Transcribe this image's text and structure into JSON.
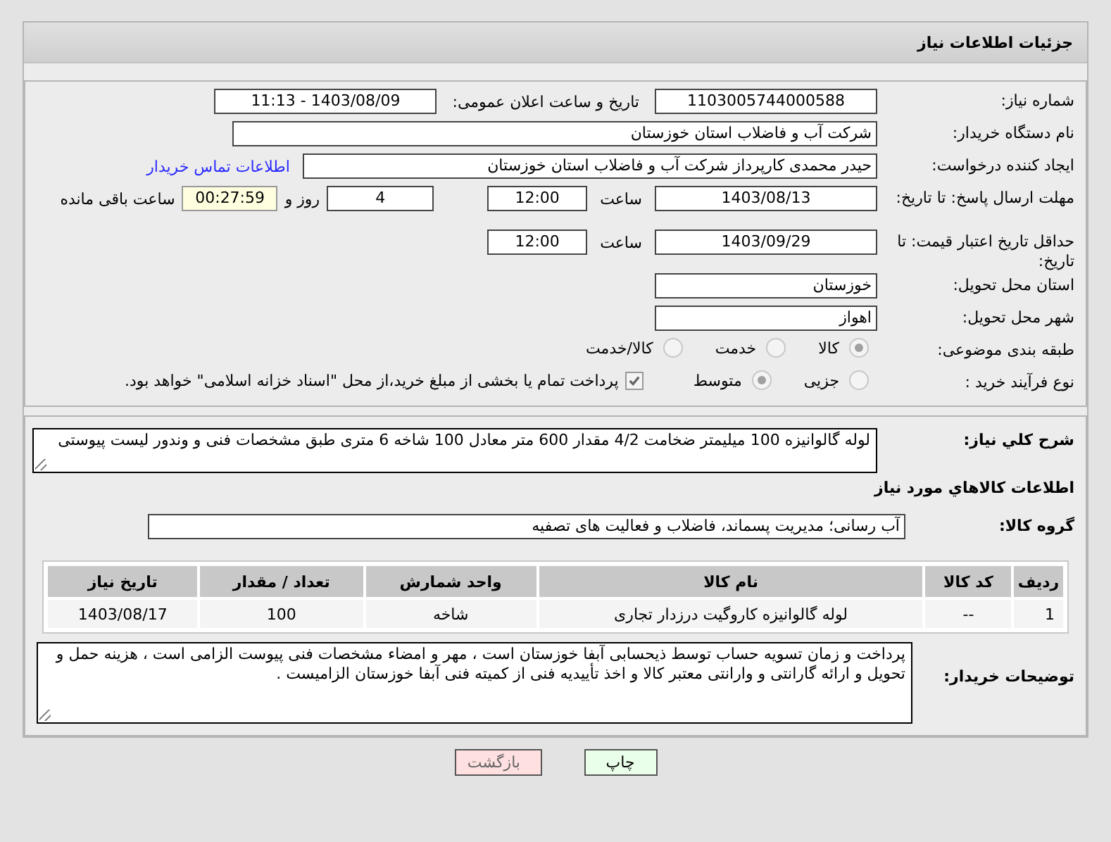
{
  "header": {
    "title": "جزئیات اطلاعات نیاز"
  },
  "need_number": {
    "label": "شماره نیاز:",
    "value": "1103005744000588"
  },
  "announce": {
    "label": "تاریخ و ساعت اعلان عمومی:",
    "value": "1403/08/09 - 11:13"
  },
  "buyer": {
    "label": "نام دستگاه خریدار:",
    "value": "شرکت آب و فاضلاب استان خوزستان"
  },
  "requester": {
    "label": "ایجاد کننده درخواست:",
    "value": "حیدر محمدی کارپرداز شرکت آب و فاضلاب استان خوزستان",
    "link": "اطلاعات تماس خریدار"
  },
  "reply_deadline": {
    "label": "مهلت ارسال پاسخ: تا تاریخ:",
    "date": "1403/08/13",
    "time_label": "ساعت",
    "time": "12:00",
    "days": "4",
    "days_label": "روز و",
    "remaining": "00:27:59",
    "remaining_label": "ساعت باقی مانده"
  },
  "price_validity": {
    "label": "حداقل تاریخ اعتبار قیمت: تا تاریخ:",
    "date": "1403/09/29",
    "time_label": "ساعت",
    "time": "12:00"
  },
  "province": {
    "label": "استان محل تحویل:",
    "value": "خوزستان"
  },
  "city": {
    "label": "شهر محل تحویل:",
    "value": "اهواز"
  },
  "category": {
    "label": "طبقه بندی موضوعی:",
    "options": [
      {
        "label": "کالا",
        "selected": true
      },
      {
        "label": "خدمت",
        "selected": false
      },
      {
        "label": "کالا/خدمت",
        "selected": false
      }
    ]
  },
  "purchase_type": {
    "label": "نوع فرآیند خرید :",
    "options": [
      {
        "label": "جزیی",
        "selected": false
      },
      {
        "label": "متوسط",
        "selected": true
      }
    ],
    "payment": {
      "text": "پرداخت تمام یا بخشی از مبلغ خرید،از محل \"اسناد خزانه اسلامی\" خواهد بود.",
      "checked": true
    }
  },
  "description": {
    "label": "شرح کلي نیاز:",
    "value": "لوله گالوانیزه 100 میلیمتر ضخامت 4/2 مقدار 600 متر معادل 100 شاخه 6 متری طبق مشخصات فنی و وندور لیست پیوستی"
  },
  "goods_heading": "اطلاعات کالاهاي مورد نیاز",
  "goods_group": {
    "label": "گروه کالا:",
    "value": "آب رسانی؛ مدیریت پسماند، فاضلاب و فعالیت های تصفیه"
  },
  "table": {
    "columns": [
      "ردیف",
      "کد کالا",
      "نام کالا",
      "واحد شمارش",
      "تعداد / مقدار",
      "تاریخ نیاز"
    ],
    "rows": [
      [
        "1",
        "--",
        "لوله گالوانیزه کاروگیت درزدار تجاری",
        "شاخه",
        "100",
        "1403/08/17"
      ]
    ]
  },
  "buyer_notes": {
    "label": "توضیحات خریدار:",
    "value": "پرداخت و زمان تسویه حساب توسط ذیحسابی آبفا خوزستان است ، مهر و امضاء مشخصات فنی پیوست الزامی است ، هزینه حمل و تحویل و ارائه گارانتی و وارانتی معتبر کالا و اخذ تأییدیه فنی از کمیته فنی آبفا خوزستان الزامیست ."
  },
  "buttons": [
    {
      "label": "چاپ",
      "kind": "print"
    },
    {
      "label": "بازگشت",
      "kind": "back"
    }
  ]
}
